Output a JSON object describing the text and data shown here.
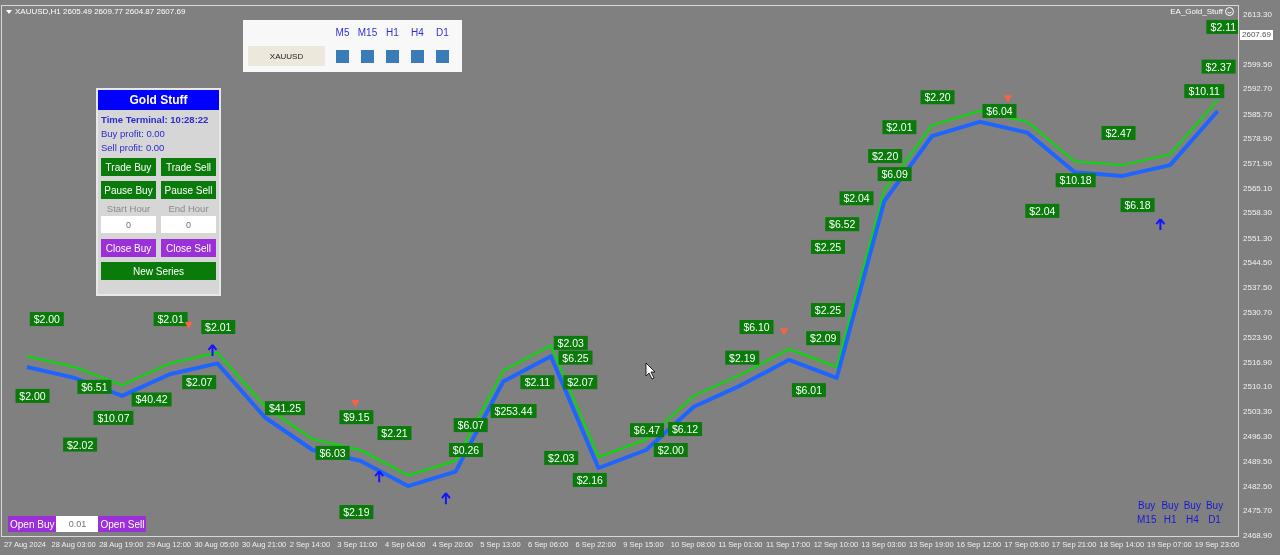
{
  "header": {
    "symbol_line": "XAUUSD,H1 2605.49 2609.77 2604.87 2607.69",
    "ea_name": "EA_Gold_Stuff"
  },
  "timeframe_panel": {
    "symbol": "XAUUSD",
    "timeframes": [
      {
        "label": "M5"
      },
      {
        "label": "M15"
      },
      {
        "label": "H1"
      },
      {
        "label": "H4"
      },
      {
        "label": "D1"
      }
    ]
  },
  "gold_panel": {
    "title": "Gold Stuff",
    "time": "Time Terminal: 10:28:22",
    "buy_profit": "Buy profit: 0.00",
    "sell_profit": "Sell profit: 0.00",
    "top_buttons": [
      {
        "label": "Trade Buy",
        "kind": "trade"
      },
      {
        "label": "Trade Sell",
        "kind": "trade"
      },
      {
        "label": "Pause Buy",
        "kind": "trade"
      },
      {
        "label": "Pause Sell",
        "kind": "trade"
      }
    ],
    "hours": [
      {
        "label": "Start Hour",
        "value": "0"
      },
      {
        "label": "End Hour",
        "value": "0"
      }
    ],
    "bottom_buttons": [
      {
        "label": "Close Buy",
        "kind": "close"
      },
      {
        "label": "Close Sell",
        "kind": "close"
      },
      {
        "label": "New Series",
        "kind": "series"
      }
    ]
  },
  "order_bar": {
    "buy_label": "Open Buy",
    "lot": "0.01",
    "sell_label": "Open Sell"
  },
  "signals": [
    {
      "action": "Buy",
      "timeframe": "M15"
    },
    {
      "action": "Buy",
      "timeframe": "H1"
    },
    {
      "action": "Buy",
      "timeframe": "H4"
    },
    {
      "action": "Buy",
      "timeframe": "D1"
    }
  ],
  "chart": {
    "current_price": "2607.69",
    "chart_data": {
      "type": "line",
      "categories": [
        "27 Aug 2024",
        "28 Aug 03:00",
        "28 Aug 19:00",
        "29 Aug 12:00",
        "30 Aug 05:00",
        "30 Aug 21:00",
        "2 Sep 14:00",
        "3 Sep 11:00",
        "4 Sep 04:00",
        "4 Sep 20:00",
        "5 Sep 13:00",
        "6 Sep 06:00",
        "6 Sep 22:00",
        "9 Sep 15:00",
        "10 Sep 08:00",
        "11 Sep 01:00",
        "11 Sep 17:00",
        "12 Sep 10:00",
        "13 Sep 03:00",
        "13 Sep 19:00",
        "16 Sep 12:00",
        "17 Sep 05:00",
        "17 Sep 21:00",
        "18 Sep 14:00",
        "19 Sep 07:00",
        "19 Sep 23:00"
      ],
      "series": [
        {
          "color": "#00e000",
          "values": [
            2519,
            2516,
            2511,
            2517,
            2520,
            2505,
            2496,
            2493,
            2486,
            2490,
            2515,
            2522,
            2491,
            2496,
            2508,
            2514,
            2521,
            2516,
            2565,
            2583,
            2587,
            2584,
            2573,
            2572,
            2575,
            2590
          ]
        },
        {
          "color": "#1e64ff",
          "values": [
            2516,
            2513,
            2508,
            2514,
            2517,
            2502,
            2493,
            2490,
            2483,
            2487,
            2512,
            2519,
            2488,
            2493,
            2505,
            2511,
            2518,
            2513,
            2562,
            2580,
            2584,
            2581,
            2570,
            2569,
            2572,
            2587
          ]
        }
      ],
      "ylim": [
        2468.6,
        2616.1
      ],
      "yticks": [
        {
          "value": 2613.3,
          "label": "2613.30"
        },
        {
          "value": 2599.5,
          "label": "2599.50"
        },
        {
          "value": 2592.7,
          "label": "2592.70"
        },
        {
          "value": 2585.7,
          "label": "2585.70"
        },
        {
          "value": 2578.9,
          "label": "2578.90"
        },
        {
          "value": 2571.9,
          "label": "2571.90"
        },
        {
          "value": 2565.1,
          "label": "2565.10"
        },
        {
          "value": 2558.3,
          "label": "2558.30"
        },
        {
          "value": 2551.3,
          "label": "2551.30"
        },
        {
          "value": 2544.5,
          "label": "2544.50"
        },
        {
          "value": 2537.5,
          "label": "2537.50"
        },
        {
          "value": 2530.7,
          "label": "2530.70"
        },
        {
          "value": 2523.9,
          "label": "2523.90"
        },
        {
          "value": 2516.9,
          "label": "2516.90"
        },
        {
          "value": 2510.1,
          "label": "2510.10"
        },
        {
          "value": 2503.3,
          "label": "2503.30"
        },
        {
          "value": 2496.3,
          "label": "2496.30"
        },
        {
          "value": 2489.5,
          "label": "2489.50"
        },
        {
          "value": 2482.5,
          "label": "2482.50"
        },
        {
          "value": 2475.7,
          "label": "2475.70"
        },
        {
          "value": 2468.9,
          "label": "2468.90"
        }
      ],
      "annotations": [
        "$2.11",
        "$2.37",
        "$10.11",
        "$2.20",
        "$6.04",
        "$2.01",
        "$2.47",
        "$2.20",
        "$6.09",
        "$10.18",
        "$2.04",
        "$6.18",
        "$2.04",
        "$6.52",
        "$2.25",
        "$2.25",
        "$2.00",
        "$2.01",
        "$2.01",
        "$6.10",
        "$2.09",
        "$2.03",
        "$6.25",
        "$2.19",
        "$2.07",
        "$2.11",
        "$2.07",
        "$6.51",
        "$6.01",
        "$2.00",
        "$40.42",
        "$41.25",
        "$253.44",
        "$9.15",
        "$10.07",
        "$6.07",
        "$6.12",
        "$6.47",
        "$2.21",
        "$2.02",
        "$0.26",
        "$2.00",
        "$6.03",
        "$2.03",
        "$2.16",
        "$2.19"
      ]
    }
  }
}
